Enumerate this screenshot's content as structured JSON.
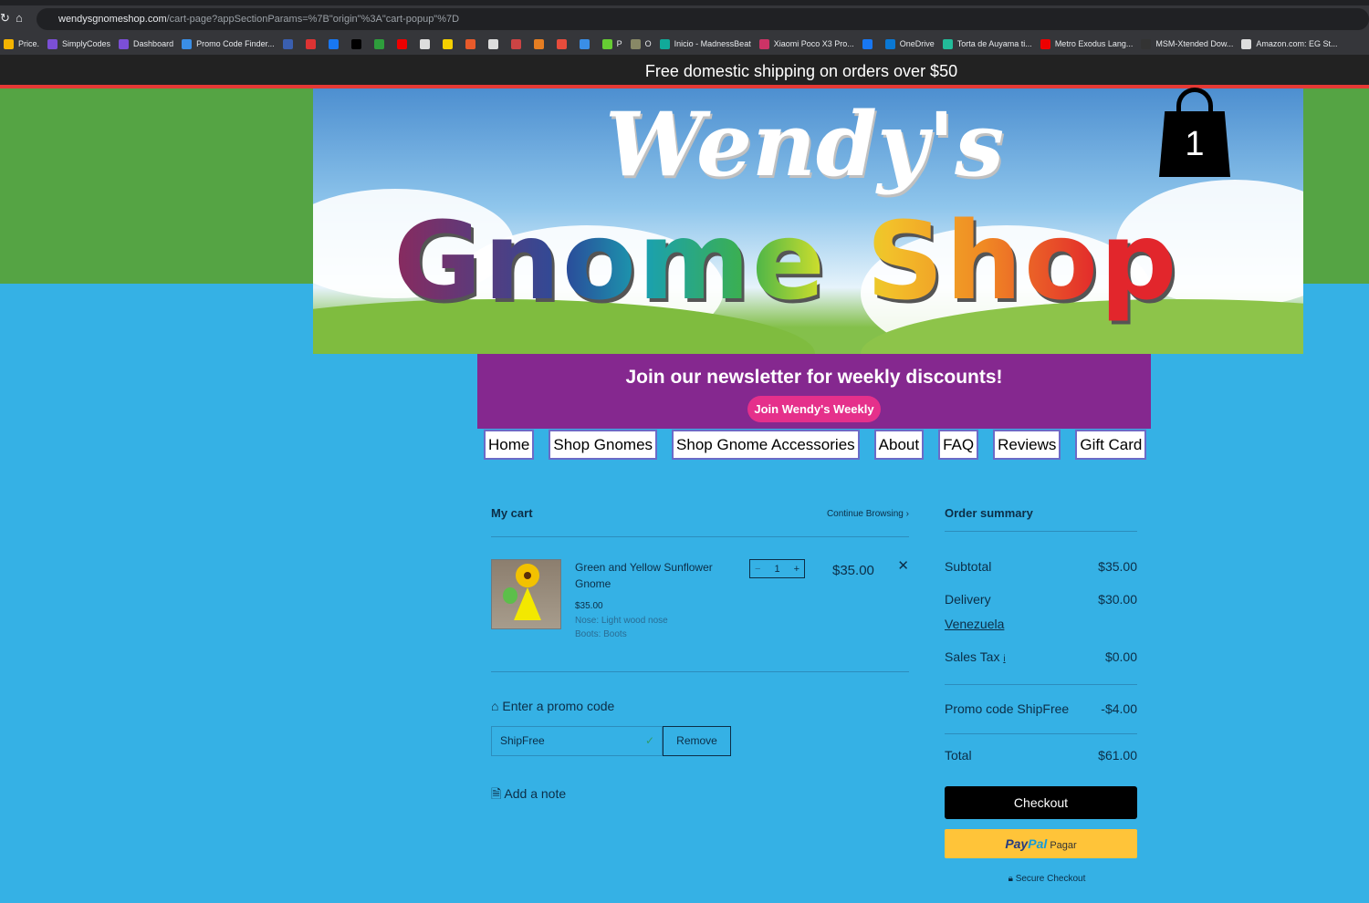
{
  "browser": {
    "url_domain": "wendysgnomeshop.com",
    "url_path": "/cart-page?appSectionParams=%7B\"origin\"%3A\"cart-popup\"%7D",
    "bookmarks": [
      {
        "label": "Price.",
        "color": "#f4b400"
      },
      {
        "label": "SimplyCodes",
        "color": "#7b4fd6"
      },
      {
        "label": "Dashboard",
        "color": "#7b4fd6"
      },
      {
        "label": "Promo Code Finder...",
        "color": "#3a8ee6"
      },
      {
        "label": "",
        "color": "#3a5fb0"
      },
      {
        "label": "",
        "color": "#d33"
      },
      {
        "label": "",
        "color": "#1877f2"
      },
      {
        "label": "",
        "color": "#000"
      },
      {
        "label": "",
        "color": "#2e9e3c"
      },
      {
        "label": "",
        "color": "#e00"
      },
      {
        "label": "",
        "color": "#ddd"
      },
      {
        "label": "",
        "color": "#f5d000"
      },
      {
        "label": "",
        "color": "#e85a2a"
      },
      {
        "label": "",
        "color": "#ddd"
      },
      {
        "label": "",
        "color": "#c44"
      },
      {
        "label": "",
        "color": "#e67e22"
      },
      {
        "label": "",
        "color": "#e74c3c"
      },
      {
        "label": "",
        "color": "#3a8ee6"
      },
      {
        "label": "P",
        "color": "#6c3"
      },
      {
        "label": "O",
        "color": "#886"
      },
      {
        "label": "Inicio - MadnessBeat",
        "color": "#1a9"
      },
      {
        "label": "Xiaomi Poco X3 Pro...",
        "color": "#c36"
      },
      {
        "label": "",
        "color": "#1877f2"
      },
      {
        "label": "OneDrive",
        "color": "#0a78d4"
      },
      {
        "label": "Torta de Auyama ti...",
        "color": "#2b9"
      },
      {
        "label": "Metro Exodus Lang...",
        "color": "#e00"
      },
      {
        "label": "MSM-Xtended Dow...",
        "color": "#333"
      },
      {
        "label": "Amazon.com: EG St...",
        "color": "#ddd"
      }
    ]
  },
  "shipping_bar": "Free domestic shipping on orders over $50",
  "banner": {
    "line1": "Wendy's",
    "line2": "Gnome Shop",
    "cart_count": "1"
  },
  "newsletter": {
    "title": "Join our newsletter for weekly discounts!",
    "button": "Join Wendy's Weekly"
  },
  "menu": [
    "Home",
    "Shop Gnomes",
    "Shop Gnome Accessories",
    "About",
    "FAQ",
    "Reviews",
    "Gift Card"
  ],
  "cart": {
    "title": "My cart",
    "continue": "Continue Browsing",
    "continue_icon": "›",
    "item": {
      "name": "Green and Yellow Sunflower Gnome",
      "price": "$35.00",
      "options": [
        "Nose: Light wood nose",
        "Boots: Boots"
      ],
      "qty": "1",
      "line_total": "$35.00"
    },
    "promo_label": "Enter a promo code",
    "promo_value": "ShipFree",
    "remove": "Remove",
    "note": "Add a note"
  },
  "summary": {
    "title": "Order summary",
    "subtotal_label": "Subtotal",
    "subtotal": "$35.00",
    "delivery_label": "Delivery",
    "delivery": "$30.00",
    "country": "Venezuela",
    "tax_label": "Sales Tax",
    "tax": "$0.00",
    "promo_label": "Promo code ShipFree",
    "promo": "-$4.00",
    "total_label": "Total",
    "total": "$61.00",
    "checkout": "Checkout",
    "paypal_pay": "Pay",
    "paypal_pal": "Pal",
    "paypal_text": "Pagar",
    "secure": "Secure Checkout"
  },
  "colors": {
    "page_bg": "#35b1e5",
    "newsletter_bg": "#85288f",
    "join_button": "#e5308b",
    "paypal": "#ffc439"
  }
}
